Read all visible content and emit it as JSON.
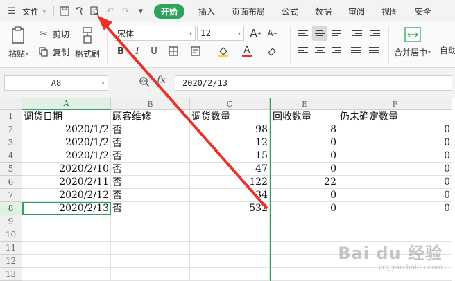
{
  "menubar": {
    "file_label": "文件",
    "tabs": [
      "开始",
      "插入",
      "页面布局",
      "公式",
      "数据",
      "审阅",
      "视图",
      "安全"
    ],
    "active_tab": "开始"
  },
  "ribbon": {
    "paste_label": "粘贴",
    "cut_label": "剪切",
    "copy_label": "复制",
    "format_painter_label": "格式刷",
    "font_name": "宋体",
    "font_size": "12",
    "merge_label": "合并居中",
    "autowrap_label": "自动"
  },
  "formula_bar": {
    "name_box": "A8",
    "fx_label": "fx",
    "formula": "2020/2/13"
  },
  "grid": {
    "columns": [
      "A",
      "B",
      "C",
      "E",
      "F"
    ],
    "row_numbers": [
      "1",
      "2",
      "3",
      "4",
      "5",
      "6",
      "7",
      "8",
      "9",
      "10",
      "11",
      "12",
      "13"
    ],
    "rows": [
      [
        "调货日期",
        "顾客维修",
        "调货数量",
        "回收数量",
        "仍未确定数量"
      ],
      [
        "2020/1/2",
        "否",
        "98",
        "8",
        "0"
      ],
      [
        "2020/1/2",
        "否",
        "12",
        "0",
        "0"
      ],
      [
        "2020/1/2",
        "否",
        "15",
        "0",
        "0"
      ],
      [
        "2020/2/10",
        "否",
        "47",
        "0",
        "0"
      ],
      [
        "2020/2/11",
        "否",
        "122",
        "22",
        "0"
      ],
      [
        "2020/2/12",
        "否",
        "34",
        "0",
        "0"
      ],
      [
        "2020/2/13",
        "否",
        "532",
        "0",
        "0"
      ]
    ],
    "active_cell": "A8"
  },
  "watermark": {
    "main": "Bai du 经验",
    "sub": "jingyan.baidu.com"
  },
  "colors": {
    "accent_green": "#2ea35b",
    "arrow_red": "#e8322b"
  }
}
